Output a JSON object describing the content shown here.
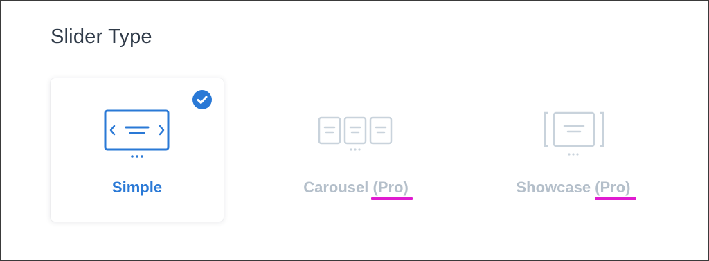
{
  "section": {
    "title": "Slider Type"
  },
  "options": [
    {
      "label": "Simple",
      "selected": true,
      "icon": "simple-slider-icon"
    },
    {
      "label": "Carousel (Pro)",
      "selected": false,
      "icon": "carousel-slider-icon"
    },
    {
      "label": "Showcase (Pro)",
      "selected": false,
      "icon": "showcase-slider-icon"
    }
  ],
  "colors": {
    "accent": "#2a79d6",
    "disabled": "#b4bfca",
    "icon_disabled": "#c9d3dc",
    "annotation_underline": "#e01bd0",
    "title": "#2f3a48"
  }
}
